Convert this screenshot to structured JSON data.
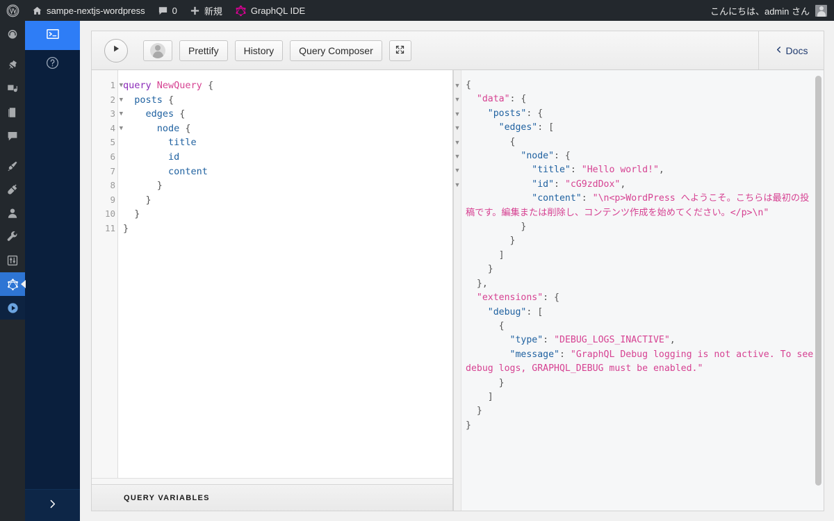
{
  "adminbar": {
    "wp_logo_icon": "wordpress-logo-icon",
    "site_home_icon": "home-icon",
    "site_name": "sampe-nextjs-wordpress",
    "comments_icon": "comment-bubble-icon",
    "comments_count": "0",
    "new_icon": "plus-icon",
    "new_label": "新規",
    "graphql_icon": "graphql-logo-icon",
    "graphql_label": "GraphQL IDE",
    "greeting": "こんにちは、admin さん",
    "avatar_icon": "user-avatar-icon"
  },
  "adminmenu": {
    "items": [
      {
        "name": "dashboard",
        "icon": "dashboard-gauge-icon",
        "current": false
      },
      {
        "name": "posts",
        "icon": "pin-icon",
        "current": false
      },
      {
        "name": "media",
        "icon": "media-icon",
        "current": false
      },
      {
        "name": "pages",
        "icon": "page-icon",
        "current": false
      },
      {
        "name": "comments",
        "icon": "comment-bubble-icon",
        "current": false
      },
      {
        "name": "appearance",
        "icon": "paintbrush-icon",
        "current": false
      },
      {
        "name": "plugins",
        "icon": "plug-icon",
        "current": false
      },
      {
        "name": "users",
        "icon": "user-icon",
        "current": false
      },
      {
        "name": "tools",
        "icon": "wrench-icon",
        "current": false
      },
      {
        "name": "settings",
        "icon": "settings-sliders-icon",
        "current": false
      },
      {
        "name": "graphql",
        "icon": "graphql-logo-icon",
        "current": true
      },
      {
        "name": "graphql-play",
        "icon": "play-circle-icon",
        "current": false
      }
    ]
  },
  "submenu": {
    "items": [
      {
        "name": "graphql-ide",
        "icon": "terminal-console-icon",
        "active": true
      },
      {
        "name": "graphql-help",
        "icon": "help-circle-icon",
        "active": false
      }
    ],
    "collapse_icon": "chevron-right-icon"
  },
  "toolbar": {
    "execute_icon": "play-triangle-icon",
    "auth_icon": "user-avatar-icon",
    "prettify_label": "Prettify",
    "history_label": "History",
    "query_composer_label": "Query Composer",
    "fullscreen_icon": "expand-fullscreen-icon",
    "docs_icon": "chevron-left-icon",
    "docs_label": "Docs"
  },
  "query_editor": {
    "line_numbers": [
      "1",
      "2",
      "3",
      "4",
      "5",
      "6",
      "7",
      "8",
      "9",
      "10",
      "11"
    ],
    "foldable_lines": [
      1,
      2,
      3,
      4
    ],
    "fold_icon": "triangle-down-icon",
    "lines": [
      [
        {
          "t": "query ",
          "c": "k-query"
        },
        {
          "t": "NewQuery",
          "c": "k-name"
        },
        {
          "t": " {",
          "c": "k-punc"
        }
      ],
      [
        {
          "t": "  ",
          "c": "k-punc"
        },
        {
          "t": "posts",
          "c": "k-field"
        },
        {
          "t": " {",
          "c": "k-punc"
        }
      ],
      [
        {
          "t": "    ",
          "c": "k-punc"
        },
        {
          "t": "edges",
          "c": "k-field"
        },
        {
          "t": " {",
          "c": "k-punc"
        }
      ],
      [
        {
          "t": "      ",
          "c": "k-punc"
        },
        {
          "t": "node",
          "c": "k-field"
        },
        {
          "t": " {",
          "c": "k-punc"
        }
      ],
      [
        {
          "t": "        ",
          "c": "k-punc"
        },
        {
          "t": "title",
          "c": "k-field"
        }
      ],
      [
        {
          "t": "        ",
          "c": "k-punc"
        },
        {
          "t": "id",
          "c": "k-field"
        }
      ],
      [
        {
          "t": "        ",
          "c": "k-punc"
        },
        {
          "t": "content",
          "c": "k-field"
        }
      ],
      [
        {
          "t": "      }",
          "c": "k-punc"
        }
      ],
      [
        {
          "t": "    }",
          "c": "k-punc"
        }
      ],
      [
        {
          "t": "  }",
          "c": "k-punc"
        }
      ],
      [
        {
          "t": "}",
          "c": "k-punc"
        }
      ]
    ]
  },
  "query_variables": {
    "title": "QUERY VARIABLES"
  },
  "result_pane": {
    "fold_count": 8,
    "fold_icon": "triangle-down-icon",
    "lines": [
      [
        {
          "t": "{",
          "c": "j-punc"
        }
      ],
      [
        {
          "t": "  ",
          "c": "j-punc"
        },
        {
          "t": "\"data\"",
          "c": "j-str"
        },
        {
          "t": ": {",
          "c": "j-punc"
        }
      ],
      [
        {
          "t": "    ",
          "c": "j-punc"
        },
        {
          "t": "\"posts\"",
          "c": "j-key"
        },
        {
          "t": ": {",
          "c": "j-punc"
        }
      ],
      [
        {
          "t": "      ",
          "c": "j-punc"
        },
        {
          "t": "\"edges\"",
          "c": "j-key"
        },
        {
          "t": ": [",
          "c": "j-punc"
        }
      ],
      [
        {
          "t": "        {",
          "c": "j-punc"
        }
      ],
      [
        {
          "t": "          ",
          "c": "j-punc"
        },
        {
          "t": "\"node\"",
          "c": "j-key"
        },
        {
          "t": ": {",
          "c": "j-punc"
        }
      ],
      [
        {
          "t": "            ",
          "c": "j-punc"
        },
        {
          "t": "\"title\"",
          "c": "j-key"
        },
        {
          "t": ": ",
          "c": "j-punc"
        },
        {
          "t": "\"Hello world!\"",
          "c": "j-str"
        },
        {
          "t": ",",
          "c": "j-punc"
        }
      ],
      [
        {
          "t": "            ",
          "c": "j-punc"
        },
        {
          "t": "\"id\"",
          "c": "j-key"
        },
        {
          "t": ": ",
          "c": "j-punc"
        },
        {
          "t": "\"cG9zdDox\"",
          "c": "j-str"
        },
        {
          "t": ",",
          "c": "j-punc"
        }
      ],
      [
        {
          "t": "            ",
          "c": "j-punc"
        },
        {
          "t": "\"content\"",
          "c": "j-key"
        },
        {
          "t": ": ",
          "c": "j-punc"
        },
        {
          "t": "\"\\n<p>WordPress へようこそ。こちらは最初の投稿です。編集または削除し、コンテンツ作成を始めてください。</p>\\n\"",
          "c": "j-str"
        }
      ],
      [
        {
          "t": "          }",
          "c": "j-punc"
        }
      ],
      [
        {
          "t": "        }",
          "c": "j-punc"
        }
      ],
      [
        {
          "t": "      ]",
          "c": "j-punc"
        }
      ],
      [
        {
          "t": "    }",
          "c": "j-punc"
        }
      ],
      [
        {
          "t": "  },",
          "c": "j-punc"
        }
      ],
      [
        {
          "t": "  ",
          "c": "j-punc"
        },
        {
          "t": "\"extensions\"",
          "c": "j-str"
        },
        {
          "t": ": {",
          "c": "j-punc"
        }
      ],
      [
        {
          "t": "    ",
          "c": "j-punc"
        },
        {
          "t": "\"debug\"",
          "c": "j-key"
        },
        {
          "t": ": [",
          "c": "j-punc"
        }
      ],
      [
        {
          "t": "      {",
          "c": "j-punc"
        }
      ],
      [
        {
          "t": "        ",
          "c": "j-punc"
        },
        {
          "t": "\"type\"",
          "c": "j-key"
        },
        {
          "t": ": ",
          "c": "j-punc"
        },
        {
          "t": "\"DEBUG_LOGS_INACTIVE\"",
          "c": "j-str"
        },
        {
          "t": ",",
          "c": "j-punc"
        }
      ],
      [
        {
          "t": "        ",
          "c": "j-punc"
        },
        {
          "t": "\"message\"",
          "c": "j-key"
        },
        {
          "t": ": ",
          "c": "j-punc"
        },
        {
          "t": "\"GraphQL Debug logging is not active. To see debug logs, GRAPHQL_DEBUG must be enabled.\"",
          "c": "j-str"
        }
      ],
      [
        {
          "t": "      }",
          "c": "j-punc"
        }
      ],
      [
        {
          "t": "    ]",
          "c": "j-punc"
        }
      ],
      [
        {
          "t": "  }",
          "c": "j-punc"
        }
      ],
      [
        {
          "t": "}",
          "c": "j-punc"
        }
      ]
    ]
  },
  "colors": {
    "adminbar_bg": "#23282d",
    "submenu_bg": "#0a1f3d",
    "accent_blue": "#2e7df6",
    "graphql_pink": "#e10098",
    "json_key": "#1f61a0",
    "json_string": "#d64292"
  }
}
